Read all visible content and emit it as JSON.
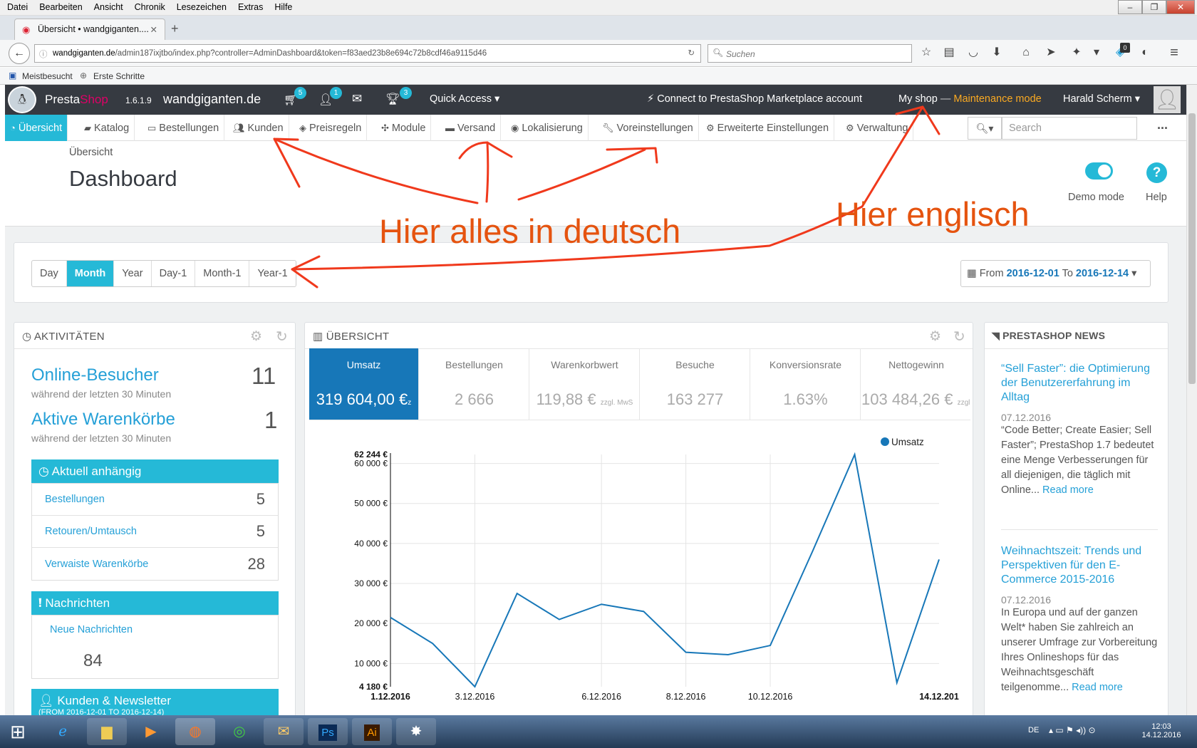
{
  "os_menu": [
    "Datei",
    "Bearbeiten",
    "Ansicht",
    "Chronik",
    "Lesezeichen",
    "Extras",
    "Hilfe"
  ],
  "browser": {
    "tab_title": "Übersicht • wandgiganten....",
    "url_domain": "wandgiganten.de",
    "url_path": "/admin187ixjtbo/index.php?controller=AdminDashboard&token=f83aed23b8e694c72b8cdf46a9115d46",
    "search_placeholder": "Suchen",
    "notif_count": "0",
    "bookmarks": [
      "Meistbesucht",
      "Erste Schritte"
    ]
  },
  "header": {
    "logo_a": "Presta",
    "logo_b": "Shop",
    "version": "1.6.1.9",
    "shop_name": "wandgiganten.de",
    "cart_badge": "5",
    "user_badge": "1",
    "trophy_badge": "3",
    "quick_access": "Quick Access",
    "connect": "Connect to PrestaShop Marketplace account",
    "my_shop": "My shop",
    "dash": "—",
    "maintenance": "Maintenance mode",
    "user": "Harald Scherm"
  },
  "nav": {
    "items": [
      "Übersicht",
      "Katalog",
      "Bestellungen",
      "Kunden",
      "Preisregeln",
      "Module",
      "Versand",
      "Lokalisierung",
      "Voreinstellungen",
      "Erweiterte Einstellungen",
      "Verwaltung"
    ],
    "search_placeholder": "Search",
    "more": "..."
  },
  "page": {
    "breadcrumb": "Übersicht",
    "title": "Dashboard",
    "demo_mode": "Demo mode",
    "help": "Help"
  },
  "period": {
    "buttons": [
      "Day",
      "Month",
      "Year",
      "Day-1",
      "Month-1",
      "Year-1"
    ],
    "active": "Month",
    "from_label": "From",
    "from": "2016-12-01",
    "to_label": "To",
    "to": "2016-12-14"
  },
  "activity": {
    "title": "AKTIVITÄTEN",
    "online_label": "Online-Besucher",
    "online_sub": "während der letzten 30 Minuten",
    "online_value": "11",
    "carts_label": "Aktive Warenkörbe",
    "carts_sub": "während der letzten 30 Minuten",
    "carts_value": "1",
    "pending_title": "Aktuell anhängig",
    "pending": [
      {
        "label": "Bestellungen",
        "value": "5"
      },
      {
        "label": "Retouren/Umtausch",
        "value": "5"
      },
      {
        "label": "Verwaiste Warenkörbe",
        "value": "28"
      }
    ],
    "messages_title": "Nachrichten",
    "new_messages": "Neue Nachrichten",
    "messages_value": "84",
    "customers_title": "Kunden & Newsletter",
    "customers_sub": "(FROM 2016-12-01 TO 2016-12-14)"
  },
  "overview": {
    "title": "ÜBERSICHT",
    "kpis": [
      {
        "label": "Umsatz",
        "value": "319 604,00 €",
        "suffix": "z"
      },
      {
        "label": "Bestellungen",
        "value": "2 666",
        "suffix": ""
      },
      {
        "label": "Warenkorbwert",
        "value": "119,88 €",
        "suffix": "zzgl. MwS"
      },
      {
        "label": "Besuche",
        "value": "163 277",
        "suffix": ""
      },
      {
        "label": "Konversionsrate",
        "value": "1.63%",
        "suffix": ""
      },
      {
        "label": "Nettogewinn",
        "value": "103 484,26 €",
        "suffix": "zzgl."
      }
    ]
  },
  "chart_data": {
    "type": "line",
    "series": [
      {
        "name": "Umsatz",
        "color": "#1777b8",
        "values": [
          21500,
          15000,
          4180,
          27500,
          21000,
          24800,
          23000,
          12800,
          12200,
          14500,
          38000,
          62244,
          5200,
          36000
        ]
      }
    ],
    "x": [
      "1.12.2016",
      "2.12.2016",
      "3.12.2016",
      "4.12.2016",
      "5.12.2016",
      "6.12.2016",
      "7.12.2016",
      "8.12.2016",
      "9.12.2016",
      "10.12.2016",
      "11.12.2016",
      "12.12.2016",
      "13.12.2016",
      "14.12.2016"
    ],
    "x_tick_labels": [
      "1.12.2016",
      "3.12.2016",
      "6.12.2016",
      "8.12.2016",
      "10.12.2016",
      "14.12.201"
    ],
    "y_tick_labels": [
      "4 180 €",
      "10 000 €",
      "20 000 €",
      "30 000 €",
      "40 000 €",
      "50 000 €",
      "60 000 €",
      "62 244 €"
    ],
    "ylim": [
      4180,
      62244
    ],
    "legend": "top-right",
    "grid": true
  },
  "news": {
    "title": "PRESTASHOP NEWS",
    "items": [
      {
        "title": "“Sell Faster”: die Optimierung der Benutzererfahrung im Alltag",
        "date": "07.12.2016",
        "text": "“Code Better; Create Easier; Sell Faster”; PrestaShop 1.7 bedeutet eine Menge Verbesserungen für all diejenigen, die täglich mit Online...",
        "more": "Read more"
      },
      {
        "title": "Weihnachtszeit: Trends und Perspektiven für den E-Commerce 2015-2016",
        "date": "07.12.2016",
        "text": "In Europa und auf der ganzen Welt* haben Sie zahlreich an unserer Umfrage zur Vorbereitung Ihres Onlineshops für das Weihnachtsgeschäft teilgenomme...",
        "more": "Read more"
      }
    ]
  },
  "annotations": {
    "german": "Hier alles in deutsch",
    "english": "Hier englisch",
    "color": "#e5530f"
  },
  "taskbar": {
    "lang": "DE",
    "time": "12:03",
    "date": "14.12.2016"
  }
}
